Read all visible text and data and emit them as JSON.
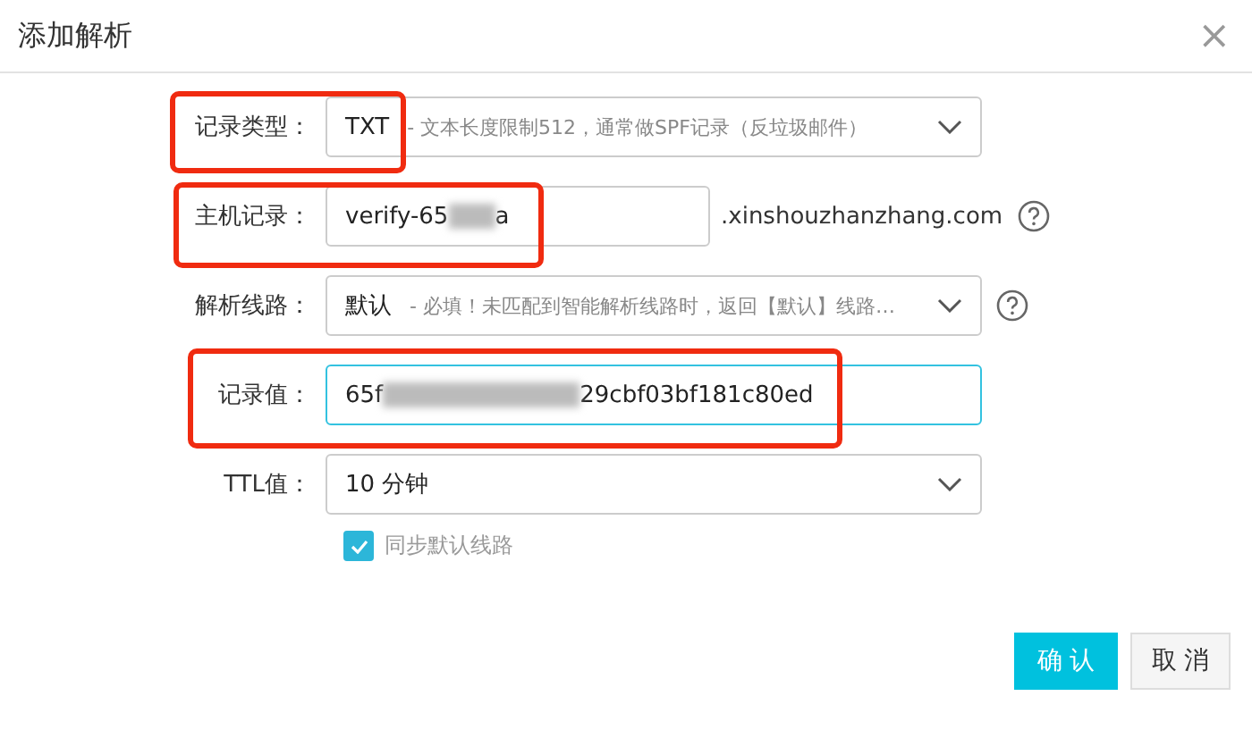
{
  "dialog": {
    "title": "添加解析",
    "close": "×"
  },
  "fields": [
    {
      "kind": "select",
      "label": "记录类型：",
      "value": "TXT",
      "hint": " - 文本长度限制512，通常做SPF记录（反垃圾邮件）",
      "highlighted": true,
      "focused": false
    },
    {
      "kind": "input",
      "label": "主机记录：",
      "value_start": "verify-65",
      "value_end": "a",
      "suffix": ".xinshouzhanzhang.com",
      "help": true,
      "highlighted": true,
      "focused": false
    },
    {
      "kind": "select",
      "label": "解析线路：",
      "value": "默认",
      "hint": " - 必填！未匹配到智能解析线路时，返回【默认】线路…",
      "help": true,
      "highlighted": false,
      "focused": false
    },
    {
      "kind": "input",
      "label": "记录值：",
      "value_start": "65f",
      "value_end": "29cbf03bf181c80ed",
      "highlighted": true,
      "focused": true
    },
    {
      "kind": "select",
      "label": "TTL值：",
      "value": "10 分钟",
      "highlighted": false,
      "focused": false
    }
  ],
  "sync": {
    "label": "同步默认线路",
    "checked": true
  },
  "buttons": [
    {
      "label": "确 认",
      "primary": true
    },
    {
      "label": "取 消",
      "primary": false
    }
  ]
}
